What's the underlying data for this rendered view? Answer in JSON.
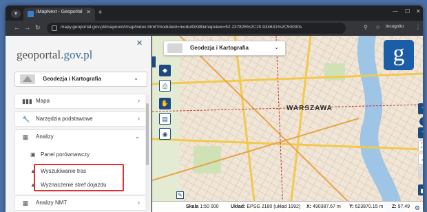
{
  "browser": {
    "tab_title": "iMapNext - Geoportal",
    "url": "mapy.geoportal.gov.pl/imapnext/imap/index.html?moduleId=modulGKiB&mapview=52.237825%2C20.934631%2C50000s",
    "incognito_label": "Incognito"
  },
  "sidebar": {
    "logo_prefix": "geoportal",
    "logo_suffix": ".gov.pl",
    "profile_label": "Geodezja i Kartografia",
    "menu": [
      {
        "label": "Mapa"
      },
      {
        "label": "Narzędzia podstawowe"
      },
      {
        "label": "Analizy"
      }
    ],
    "submenu": [
      {
        "label": "Panel porównawczy"
      },
      {
        "label": "Wyszukiwanie tras"
      },
      {
        "label": "Wyznaczenie stref dojazdu"
      }
    ],
    "menu_bottom": {
      "label": "Analizy NMT"
    }
  },
  "map": {
    "profile_label": "Geodezja i Kartografia",
    "city_label": "WARSZAWA",
    "zoom_level": "9"
  },
  "status": {
    "scale_label": "Skala",
    "scale_value": "1:50 000",
    "crs_label": "Układ:",
    "crs_value": "EPSG 2180 (układ 1992)",
    "x_label": "X:",
    "x_value": "490387.67 m",
    "y_label": "Y:",
    "y_value": "623870.15 m",
    "z_label": "Z:",
    "z_value": "97.49"
  },
  "colors": {
    "accent": "#1c4a82",
    "highlight_box": "#e0302f",
    "road_major": "#f2c94c",
    "water": "#9ec4e6"
  }
}
